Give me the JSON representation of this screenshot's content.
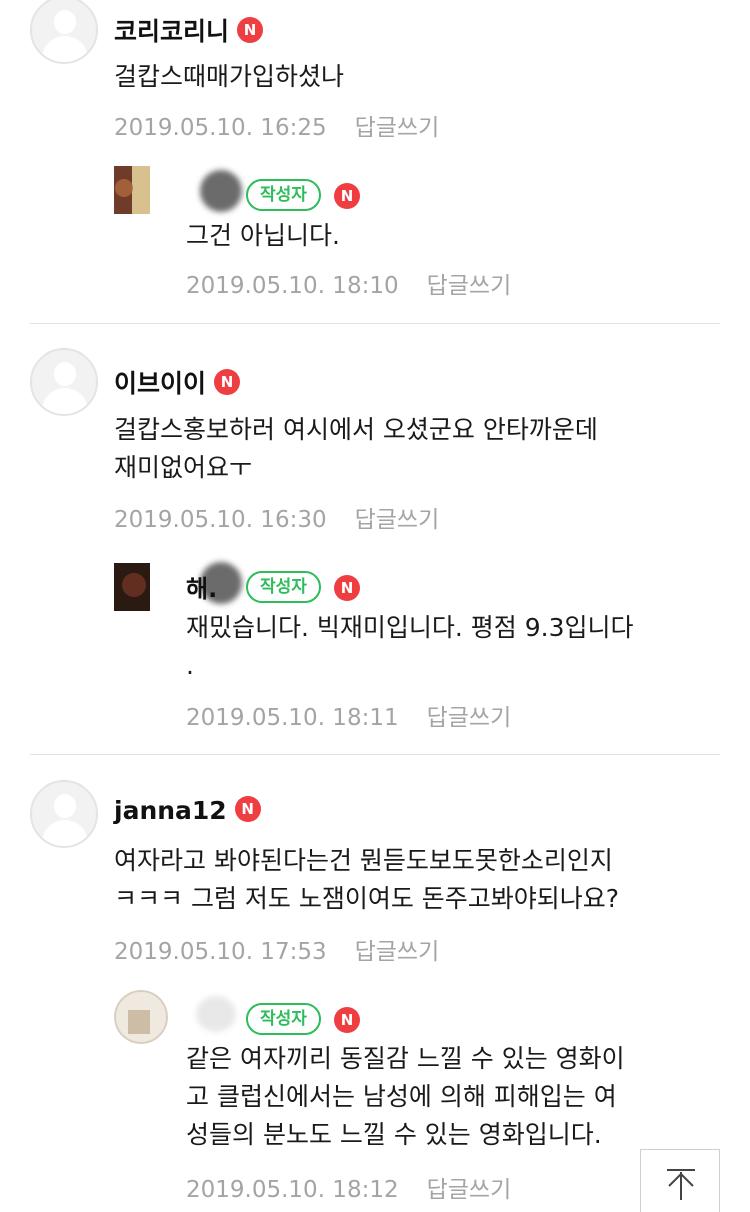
{
  "comments": [
    {
      "nickname": "코리코리니",
      "new_badge": "N",
      "text": "걸캅스때매가입하셨나",
      "date": "2019.05.10. 16:25",
      "reply_label": "답글쓰기",
      "reply": {
        "nickname_visible": "",
        "author_badge": "작성자",
        "new_badge": "N",
        "text": "그건 아닙니다.",
        "date": "2019.05.10. 18:10",
        "reply_label": "답글쓰기"
      }
    },
    {
      "nickname": "이브이이",
      "new_badge": "N",
      "text": "걸캅스홍보하러 여시에서 오셨군요 안타까운데\n재미없어요ㅜ",
      "date": "2019.05.10. 16:30",
      "reply_label": "답글쓰기",
      "reply": {
        "nickname_visible": "해.",
        "author_badge": "작성자",
        "new_badge": "N",
        "text": "재밌습니다. 빅재미입니다. 평점 9.3입니다\n.",
        "date": "2019.05.10. 18:11",
        "reply_label": "답글쓰기"
      }
    },
    {
      "nickname": "janna12",
      "new_badge": "N",
      "text": "여자라고 봐야된다는건 뭔듣도보도못한소리인지\nㅋㅋㅋ 그럼 저도 노잼이여도 돈주고봐야되나요?",
      "date": "2019.05.10. 17:53",
      "reply_label": "답글쓰기",
      "reply": {
        "nickname_visible": "",
        "author_badge": "작성자",
        "new_badge": "N",
        "text": "같은 여자끼리 동질감 느낄 수 있는 영화이\n고 클럽신에서는 남성에 의해 피해입는 여\n성들의 분노도 느낄 수 있는 영화입니다.",
        "date": "2019.05.10. 18:12",
        "reply_label": "답글쓰기"
      }
    }
  ],
  "scroll_top_icon": "arrow-up-to-top-icon",
  "colors": {
    "new_badge": "#ef3e42",
    "author_badge": "#2dbd5a",
    "meta_text": "#a4a4a4",
    "divider": "#e2e2e2"
  }
}
